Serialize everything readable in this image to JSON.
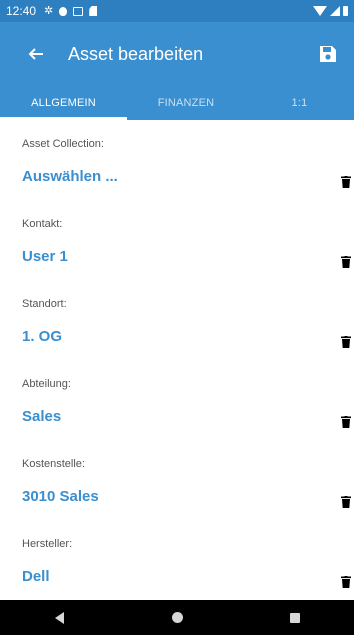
{
  "status_bar": {
    "time": "12:40",
    "icons": [
      "gear-icon",
      "notification-dot-icon",
      "image-icon",
      "sd-card-icon",
      "wifi-icon",
      "signal-icon",
      "battery-icon"
    ]
  },
  "app_bar": {
    "title": "Asset bearbeiten",
    "back_icon": "arrow-left-icon",
    "save_icon": "floppy-disk-icon"
  },
  "tabs": [
    {
      "label": "ALLGEMEIN",
      "active": true
    },
    {
      "label": "FINANZEN",
      "active": false
    },
    {
      "label": "1:1",
      "active": false
    }
  ],
  "fields": [
    {
      "label": "Asset Collection:",
      "value": "Auswählen ..."
    },
    {
      "label": "Kontakt:",
      "value": "User 1"
    },
    {
      "label": "Standort:",
      "value": "1. OG"
    },
    {
      "label": "Abteilung:",
      "value": "Sales"
    },
    {
      "label": "Kostenstelle:",
      "value": "3010 Sales"
    },
    {
      "label": "Hersteller:",
      "value": "Dell"
    }
  ],
  "nav_bar": {
    "icons": [
      "nav-back-icon",
      "nav-home-icon",
      "nav-recents-icon"
    ]
  },
  "colors": {
    "primary": "#3a8fd0",
    "status_bar": "#2d7fbf",
    "value_text": "#3a8fd0",
    "label_text": "#555555",
    "nav_bar": "#000000"
  }
}
